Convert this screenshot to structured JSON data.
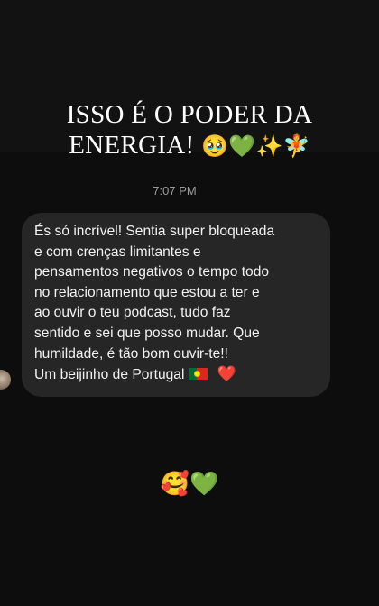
{
  "story": {
    "title_line1": "ISSO É O PODER DA",
    "title_line2": "ENERGIA!",
    "title_emojis": [
      "🥹",
      "💚",
      "✨",
      "🧚"
    ]
  },
  "chat": {
    "timestamp": "7:07 PM",
    "message_lines": [
      "És só incrível! Sentia super bloqueada",
      "e com crenças limitantes e",
      "pensamentos negativos o tempo todo",
      "no relacionamento que estou a ter e",
      "ao ouvir o teu podcast, tudo faz",
      "sentido e sei que posso mudar. Que",
      "humildade, é tão bom ouvir-te!!",
      "Um beijinho de Portugal"
    ],
    "message_flag": "portugal-flag-icon",
    "message_heart": "❤️"
  },
  "bottom": {
    "emojis": [
      "🥰",
      "💚"
    ]
  },
  "colors": {
    "background": "#0d0d0d",
    "bubble": "#262626",
    "text": "#f2f2f2",
    "timestamp": "#9a9a9a"
  }
}
